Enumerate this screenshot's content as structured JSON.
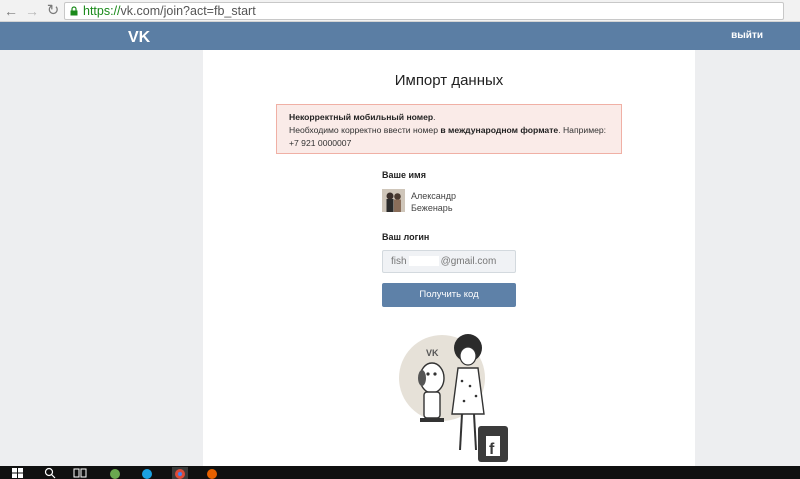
{
  "browser": {
    "url_secure": "https://",
    "url_rest": "vk.com/join?act=fb_start"
  },
  "header": {
    "logout": "выйти"
  },
  "page": {
    "title": "Импорт данных"
  },
  "error": {
    "line1_bold": "Некорректный мобильный номер",
    "line1_end": ".",
    "line2_start": "Необходимо корректно ввести номер ",
    "line2_bold": "в международном формате",
    "line2_end": ". Например:",
    "line3": "+7 921 0000007"
  },
  "name_field": {
    "label": "Ваше имя",
    "first_name": "Александр",
    "last_name": "Беженарь"
  },
  "login_field": {
    "label": "Ваш логин",
    "value_start": "fish",
    "value_end": "@gmail.com"
  },
  "button": {
    "get_code": "Получить код"
  },
  "colors": {
    "vk_header": "#5b7ea4",
    "button": "#5e81a8",
    "error_bg": "#faebe8",
    "error_border": "#f0b0a5"
  }
}
